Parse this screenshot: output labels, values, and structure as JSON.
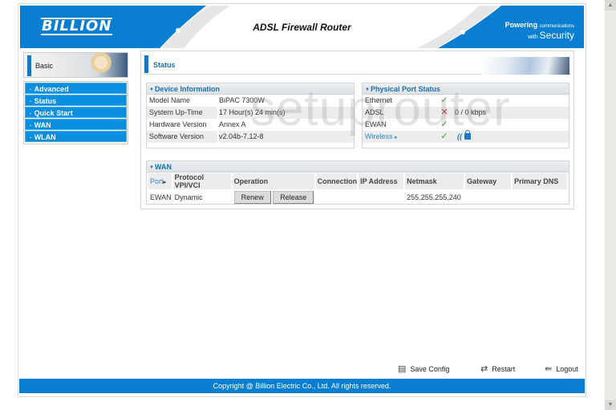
{
  "header": {
    "logo": "BILLION",
    "title": "ADSL Firewall Router",
    "tagline_line1": "Powering",
    "tagline_line1_small": "communications",
    "tagline_line2_small": "with",
    "tagline_line2": "Security",
    "brand_color": "#0a7ed0"
  },
  "sidebar": {
    "section": "Basic",
    "items": [
      {
        "label": "Advanced"
      },
      {
        "label": "Status"
      },
      {
        "label": "Quick Start"
      },
      {
        "label": "WAN"
      },
      {
        "label": "WLAN"
      }
    ]
  },
  "main": {
    "title": "Status",
    "device_info": {
      "title": "Device Information",
      "rows": [
        {
          "key": "Model Name",
          "value": "BiPAC 7300W"
        },
        {
          "key": "System Up-Time",
          "value": "17 Hour(s) 24 min(s)"
        },
        {
          "key": "Hardware Version",
          "value": "Annex A"
        },
        {
          "key": "Software Version",
          "value": "v2.04b-7.12-8"
        }
      ]
    },
    "port_status": {
      "title": "Physical Port Status",
      "rows": [
        {
          "key": "Ethernet",
          "status": "ok",
          "icon": "✓",
          "info": ""
        },
        {
          "key": "ADSL",
          "status": "down",
          "icon": "✕",
          "info": "0 / 0 kbps"
        },
        {
          "key": "EWAN",
          "status": "ok",
          "icon": "✓",
          "info": ""
        },
        {
          "key": "Wireless",
          "status": "ok",
          "icon": "✓",
          "info": ""
        }
      ],
      "wireless_arrow": "▸"
    },
    "wan": {
      "title": "WAN",
      "columns": [
        "Port",
        "Protocol",
        "VPI/VCI",
        "Operation",
        "",
        "Connection",
        "IP Address",
        "Netmask",
        "Gateway",
        "Primary DNS"
      ],
      "port_arrow": "▸",
      "rows": [
        {
          "port": "EWAN",
          "protocol": "Dynamic",
          "vpi_vci": "",
          "renew": "Renew",
          "release": "Release",
          "connection": "",
          "ip": "",
          "netmask": "255.255.255.240",
          "gateway": "",
          "dns": ""
        }
      ]
    }
  },
  "watermark": "setuprouter",
  "actions": {
    "save": "Save Config",
    "restart": "Restart",
    "logout": "Logout"
  },
  "footer": {
    "copyright": "Copyright @ Billion Electric Co., Ltd. All rights reserved."
  }
}
